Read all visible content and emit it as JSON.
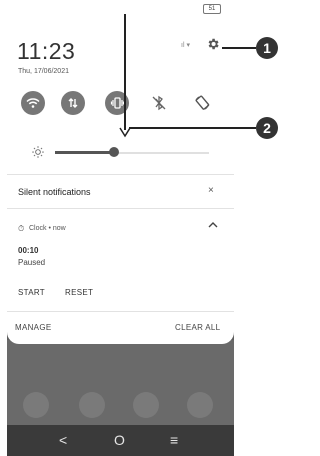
{
  "status_bar": {
    "battery": "51"
  },
  "header": {
    "time": "11:23",
    "date": "Thu, 17/06/2021",
    "signal": "ıl ▾"
  },
  "quick_settings": [
    {
      "name": "wifi-icon",
      "active": true
    },
    {
      "name": "mobile-data-icon",
      "active": true
    },
    {
      "name": "vibrate-icon",
      "active": true
    },
    {
      "name": "bluetooth-off-icon",
      "active": false
    },
    {
      "name": "auto-rotate-icon",
      "active": false
    }
  ],
  "brightness": {
    "level": 0.38
  },
  "silent_notifications": {
    "title": "Silent notifications",
    "dismiss": "×"
  },
  "notification": {
    "app": "Clock • now",
    "title": "00:10",
    "body": "Paused",
    "actions": [
      "START",
      "RESET"
    ]
  },
  "footer": {
    "manage": "MANAGE",
    "clear_all": "CLEAR ALL"
  },
  "nav": {
    "back": "<",
    "home": "O",
    "recents": "≡"
  },
  "callouts": {
    "one": "1",
    "two": "2"
  }
}
